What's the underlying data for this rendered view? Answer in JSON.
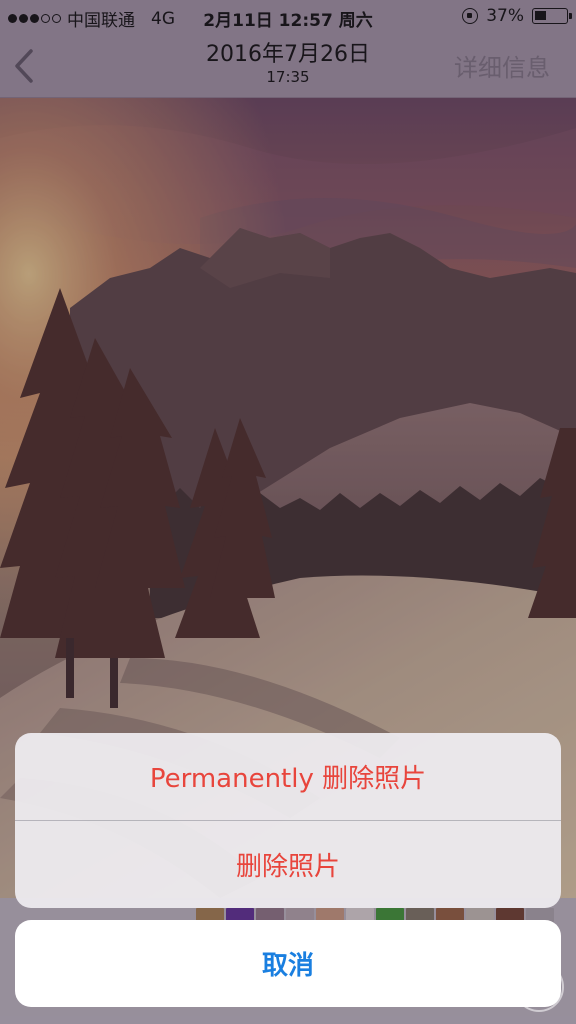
{
  "status_bar": {
    "carrier": "中国联通",
    "network": "4G",
    "datetime": "2月11日 12:57 周六",
    "battery": "37%",
    "battery_level": 0.37
  },
  "nav": {
    "title": "2016年7月26日",
    "subtitle": "17:35",
    "detail_label": "详细信息"
  },
  "action_sheet": {
    "permanent_delete_label": "Permanently 删除照片",
    "delete_label": "删除照片",
    "cancel_label": "取消"
  },
  "colors": {
    "destructive": "#e8453c",
    "cancel": "#1a7fe0"
  }
}
